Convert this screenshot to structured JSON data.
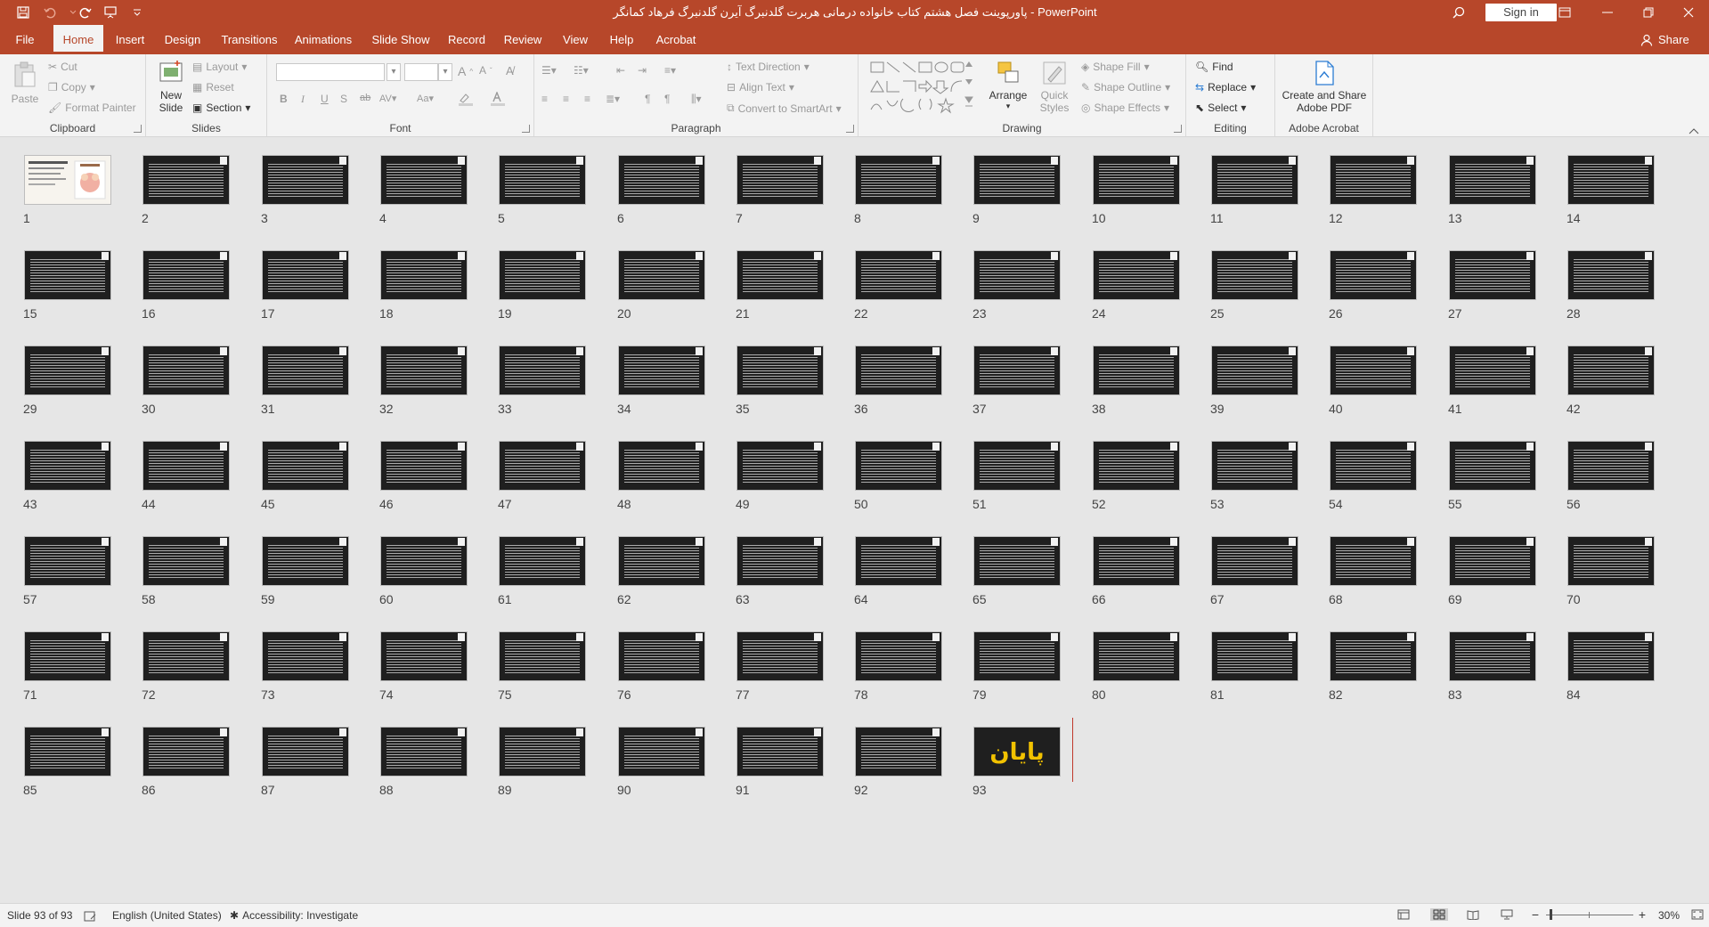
{
  "titlebar": {
    "title": "پاورپوینت فصل هشتم کتاب خانواده درمانی هربرت گلدنبرگ آیرن گلدنبرگ فرهاد کمانگر  -  PowerPoint",
    "signin": "Sign in"
  },
  "tabs": [
    "File",
    "Home",
    "Insert",
    "Design",
    "Transitions",
    "Animations",
    "Slide Show",
    "Record",
    "Review",
    "View",
    "Help",
    "Acrobat"
  ],
  "share": "Share",
  "ribbon": {
    "clipboard": {
      "label": "Clipboard",
      "paste": "Paste",
      "cut": "Cut",
      "copy": "Copy",
      "format_painter": "Format Painter"
    },
    "slides": {
      "label": "Slides",
      "new_slide_1": "New",
      "new_slide_2": "Slide",
      "layout": "Layout",
      "reset": "Reset",
      "section": "Section"
    },
    "font": {
      "label": "Font"
    },
    "paragraph": {
      "label": "Paragraph",
      "text_direction": "Text Direction",
      "align_text": "Align Text",
      "convert": "Convert to SmartArt"
    },
    "drawing": {
      "label": "Drawing",
      "arrange": "Arrange",
      "quick_1": "Quick",
      "quick_2": "Styles",
      "shape_fill": "Shape Fill",
      "shape_outline": "Shape Outline",
      "shape_effects": "Shape Effects"
    },
    "editing": {
      "label": "Editing",
      "find": "Find",
      "replace": "Replace",
      "select": "Select"
    },
    "acrobat": {
      "label": "Adobe Acrobat",
      "create_1": "Create and Share",
      "create_2": "Adobe PDF"
    }
  },
  "slides": {
    "count": 93,
    "final_text": "پایان"
  },
  "status": {
    "slide_info": "Slide 93 of 93",
    "language": "English (United States)",
    "accessibility": "Accessibility: Investigate",
    "zoom": "30%"
  }
}
